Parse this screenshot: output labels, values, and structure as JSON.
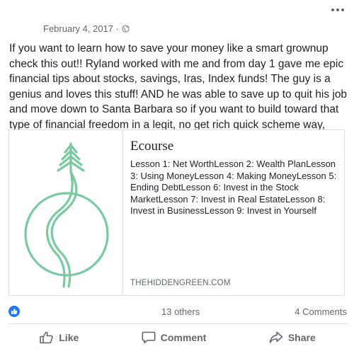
{
  "post": {
    "date": "February 4, 2017 ·",
    "text": "If you want to learn how to save your money like a smart grownup check this out!! Ryland worked with me               and from day 1 gave me epic financial tips about stocks, savings, Iras, Index funds! The guy is a genius and loves this stuff! AND he was able to save up to quit his job and move down to Santa Barbara so if you want to build toward that type of financial freedom in a legit, no get rich quick scheme way, check it out!",
    "privacy_icon": "globe-icon"
  },
  "link_card": {
    "title": "Ecourse",
    "description": "Lesson 1: Net WorthLesson 2: Wealth PlanLesson 3: Using MoneyLesson 4: Making MoneyLesson 5: Ending DebtLesson 6: Invest in the Stock MarketLesson 7: Invest in Real EstateLesson 8: Invest in BusinessLesson 9: Invest in Yourself",
    "domain": "THEHIDDENGREEN.COM",
    "logo_color": "#79c9a1"
  },
  "reactions": {
    "others": "13 others",
    "comments": "4 Comments",
    "like_color": "#2078f4"
  },
  "actions": {
    "like": "Like",
    "comment": "Comment",
    "share": "Share"
  }
}
